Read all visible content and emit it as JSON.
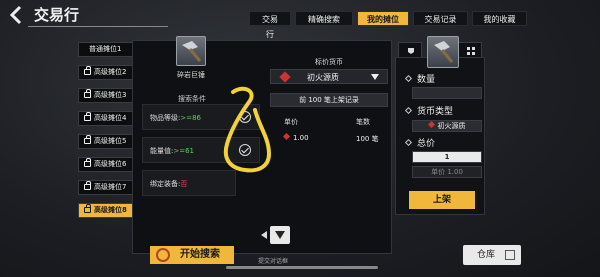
{
  "header": {
    "title": "交易行",
    "tabs": [
      {
        "label": "交易行",
        "active": false
      },
      {
        "label": "精确搜索",
        "active": false
      },
      {
        "label": "我的摊位",
        "active": true
      },
      {
        "label": "交易记录",
        "active": false
      },
      {
        "label": "我的收藏",
        "active": false
      }
    ]
  },
  "slots": [
    {
      "label": "普通摊位1",
      "locked": false,
      "active": false
    },
    {
      "label": "高级摊位2",
      "locked": true,
      "active": false
    },
    {
      "label": "高级摊位3",
      "locked": true,
      "active": false
    },
    {
      "label": "高级摊位4",
      "locked": true,
      "active": false
    },
    {
      "label": "高级摊位5",
      "locked": true,
      "active": false
    },
    {
      "label": "高级摊位6",
      "locked": true,
      "active": false
    },
    {
      "label": "高级摊位7",
      "locked": true,
      "active": false
    },
    {
      "label": "高级摊位8",
      "locked": true,
      "active": true
    }
  ],
  "search_dialog": {
    "item_name": "碎岩巨锤",
    "section_label": "搜索条件",
    "conditions": [
      {
        "label": "物品等级:",
        "value": ">=86",
        "checked": true
      },
      {
        "label": "能量值:",
        "value": ">=61",
        "checked": true
      },
      {
        "label": "绑定装备:",
        "value": "否",
        "checked": false
      }
    ],
    "price_header": "标价货币",
    "currency": "初火源质",
    "top_records": "前 100 笔上架记录",
    "col_price": "单价",
    "col_count": "笔数",
    "records": [
      {
        "price": "1.00",
        "count": "100 笔"
      }
    ],
    "start_search": "开始搜索",
    "bottom_text": "提交对话框"
  },
  "right_panel": {
    "quantity_label": "数量",
    "quantity_value": "",
    "currency_type_label": "货币类型",
    "currency_type_value": "初火源质",
    "total_label": "总价",
    "total_value": "1",
    "unit_price": "单价 1.00",
    "list_button": "上架"
  },
  "warehouse": "仓库",
  "colors": {
    "accent": "#f1b73a",
    "green_value": "#5bd15b",
    "red_value": "#e24a4a"
  }
}
